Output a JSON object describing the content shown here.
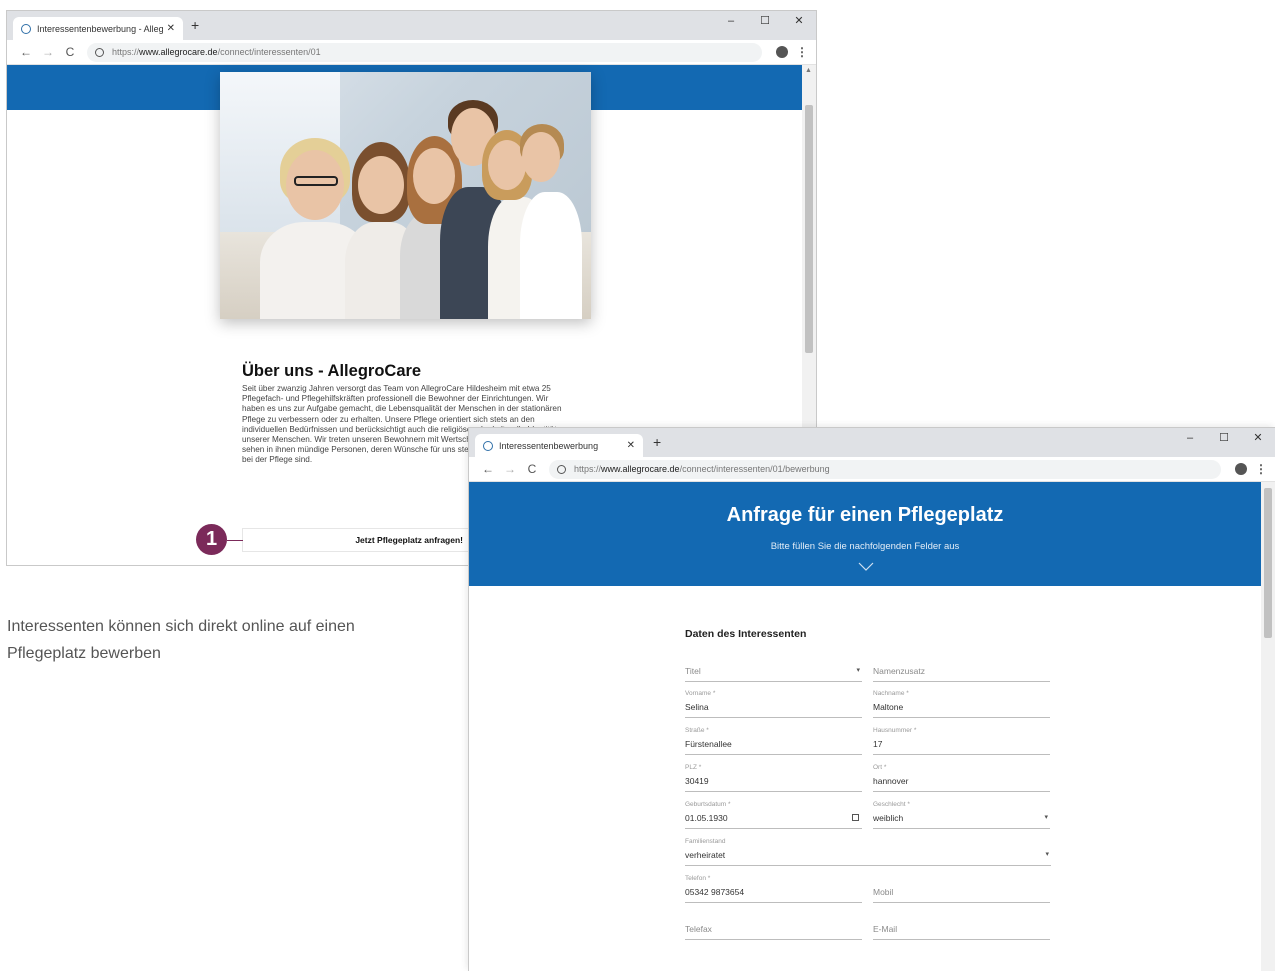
{
  "window1": {
    "tab_title": "Interessentenbewerbung - Allegr",
    "tab_close": "✕",
    "new_tab": "+",
    "controls": {
      "minimize": "–",
      "maximize": "☐",
      "close": "✕"
    },
    "url": {
      "scheme": "https://",
      "host": "www.allegrocare.de",
      "path": "/connect/interessenten/01"
    },
    "about_title": "Über uns - AllegroCare",
    "about_text": "Seit über zwanzig Jahren versorgt das Team von AllegroCare Hildesheim mit etwa 25 Pflegefach- und Pflegehilfskräften professionell die Bewohner der Einrichtungen. Wir haben es uns zur Aufgabe gemacht, die Lebensqualität der Menschen in der stationären Pflege zu verbessern oder zu erhalten. Unsere Pflege orientiert sich stets an den individuellen Bedürfnissen und berücksichtigt auch die religiöse oder kulturelle Identität unserer Menschen. Wir treten unseren Bewohnern mit Wertschätzung entgegen und sehen in ihnen mündige Personen, deren Wünsche für uns stets von höchster Wichtigkeit bei der Pflege sind.",
    "cta_label": "Jetzt Pflegeplatz anfragen!",
    "callout_number": "1"
  },
  "caption": "Interessenten können sich direkt online auf einen Pflegeplatz bewerben",
  "window2": {
    "tab_title": "Interessentenbewerbung",
    "tab_close": "✕",
    "new_tab": "+",
    "controls": {
      "minimize": "–",
      "maximize": "☐",
      "close": "✕"
    },
    "url": {
      "scheme": "https://",
      "host": "www.allegrocare.de",
      "path": "/connect/interessenten/01/bewerbung"
    },
    "form_title": "Anfrage für einen Pflegeplatz",
    "form_subtitle": "Bitte füllen Sie die nachfolgenden Felder aus",
    "section_title": "Daten des Interessenten",
    "fields": {
      "titel": {
        "placeholder": "Titel"
      },
      "namenszusatz": {
        "placeholder": "Namenzusatz"
      },
      "vorname": {
        "label": "Vorname *",
        "value": "Selina"
      },
      "nachname": {
        "label": "Nachname *",
        "value": "Maltone"
      },
      "strasse": {
        "label": "Straße *",
        "value": "Fürstenallee"
      },
      "hausnummer": {
        "label": "Hausnummer *",
        "value": "17"
      },
      "plz": {
        "label": "PLZ *",
        "value": "30419"
      },
      "ort": {
        "label": "Ort *",
        "value": "hannover"
      },
      "geburtsdatum": {
        "label": "Geburtsdatum *",
        "value": "01.05.1930"
      },
      "geschlecht": {
        "label": "Geschlecht *",
        "value": "weiblich"
      },
      "familienstand": {
        "label": "Familienstand",
        "value": "verheiratet"
      },
      "telefon": {
        "label": "Telefon *",
        "value": "05342 9873654"
      },
      "mobil": {
        "placeholder": "Mobil"
      },
      "telefax": {
        "placeholder": "Telefax"
      },
      "email": {
        "placeholder": "E-Mail"
      }
    }
  },
  "icons": {
    "back": "←",
    "forward": "→",
    "reload": "C",
    "dropdown": "▾",
    "kebab": "⋮"
  },
  "colors": {
    "brand_blue": "#1369b2",
    "callout": "#7b2a5a"
  }
}
